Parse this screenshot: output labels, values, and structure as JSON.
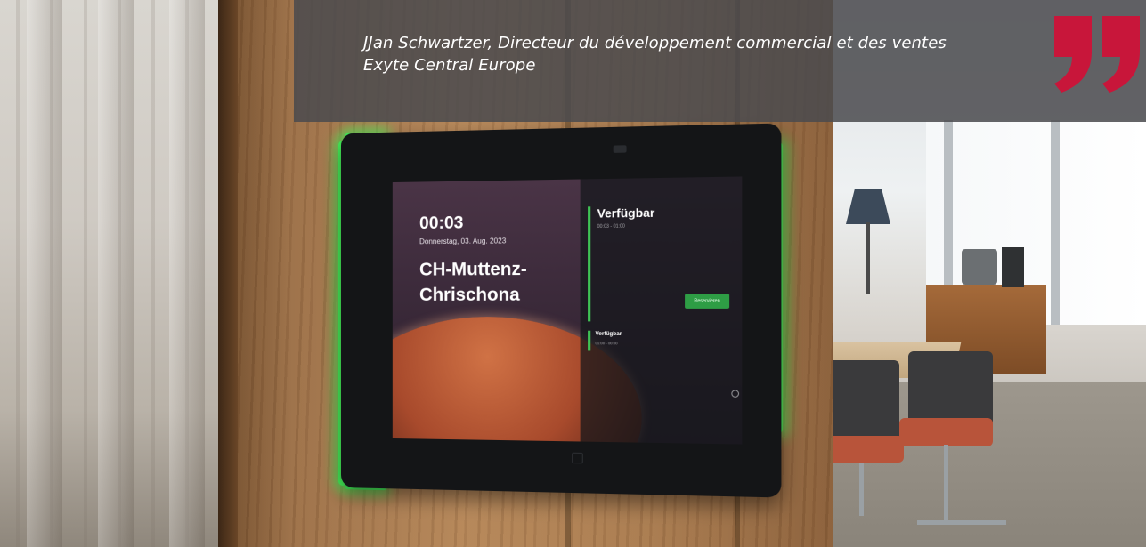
{
  "quote": {
    "line1": "JJan Schwartzer, Directeur du développement commercial et des ventes",
    "line2": "Exyte Central Europe",
    "mark_color": "#c8163a"
  },
  "tablet": {
    "time": "00:03",
    "date": "Donnerstag, 03. Aug. 2023",
    "room_name": "CH-Muttenz-Chrischona",
    "status": "Verfügbar",
    "status_time": "00:03 - 01:00",
    "reserve_label": "Reservieren",
    "next_status": "Verfügbar",
    "next_time": "01:00 - 00:00",
    "led_color": "#46f25a",
    "accent_green": "#3fc455"
  }
}
